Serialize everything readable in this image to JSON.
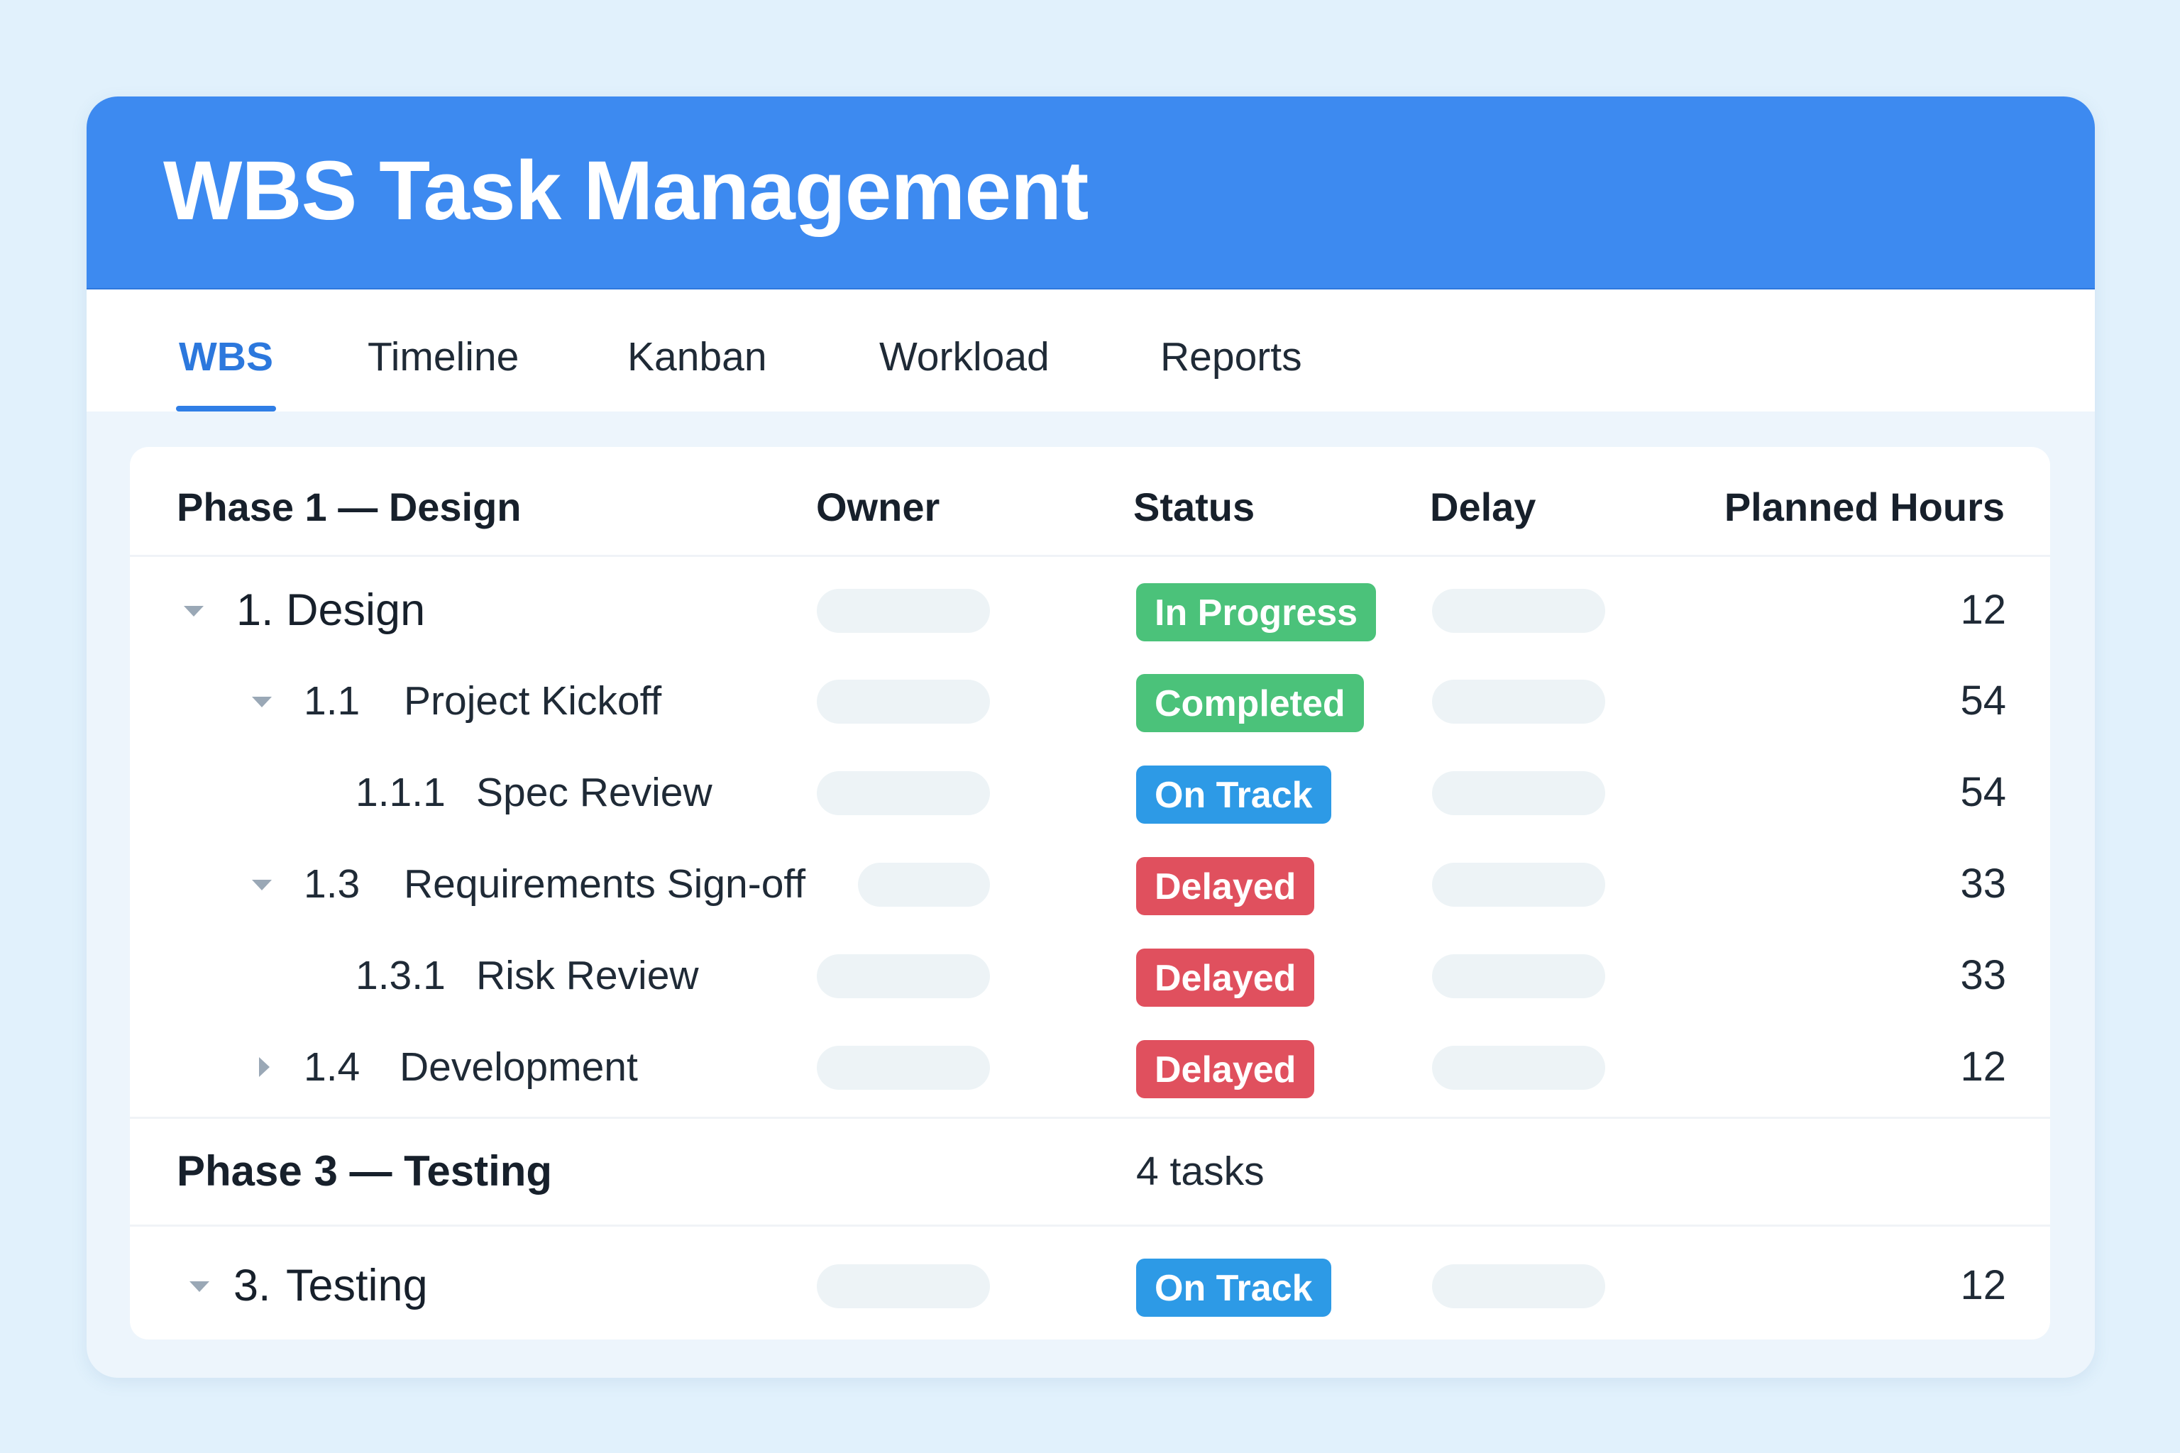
{
  "app": {
    "title": "WBS Task Management"
  },
  "tabs": [
    {
      "label": "WBS",
      "active": true
    },
    {
      "label": "Timeline",
      "active": false
    },
    {
      "label": "Kanban",
      "active": false
    },
    {
      "label": "Workload",
      "active": false
    },
    {
      "label": "Reports",
      "active": false
    }
  ],
  "table": {
    "columns": {
      "phase": "Phase 1 — Design",
      "owner": "Owner",
      "status": "Status",
      "delay": "Delay",
      "hours": "Planned Hours"
    },
    "rows": [
      {
        "num": "1.",
        "name": "Design",
        "status": "In Progress",
        "status_color": "#4bc27a",
        "hours": "12",
        "toggle": "expanded"
      },
      {
        "num": "1.1",
        "name": "Project Kickoff",
        "status": "Completed",
        "status_color": "#4bc27a",
        "hours": "54",
        "toggle": "expanded"
      },
      {
        "num": "1.1.1",
        "name": "Spec Review",
        "status": "On Track",
        "status_color": "#2d9ae6",
        "hours": "54",
        "toggle": "none"
      },
      {
        "num": "1.3",
        "name": "Requirements Sign-off",
        "status": "Delayed",
        "status_color": "#e0505e",
        "hours": "33",
        "toggle": "expanded"
      },
      {
        "num": "1.3.1",
        "name": "Risk Review",
        "status": "Delayed",
        "status_color": "#e0505e",
        "hours": "33",
        "toggle": "none"
      },
      {
        "num": "1.4",
        "name": "Development",
        "status": "Delayed",
        "status_color": "#e0505e",
        "hours": "12",
        "toggle": "collapsed"
      }
    ],
    "phase3": {
      "title": "Phase 3 — Testing",
      "task_count": "4 tasks",
      "rows": [
        {
          "num": "3.",
          "name": "Testing",
          "status": "On Track",
          "status_color": "#2d9ae6",
          "hours": "12",
          "toggle": "expanded"
        }
      ]
    }
  },
  "colors": {
    "header_blue": "#3d8af0",
    "accent": "#2f7ee6",
    "completed": "#4bc27a",
    "on_track": "#2d9ae6",
    "delayed": "#e0505e"
  }
}
